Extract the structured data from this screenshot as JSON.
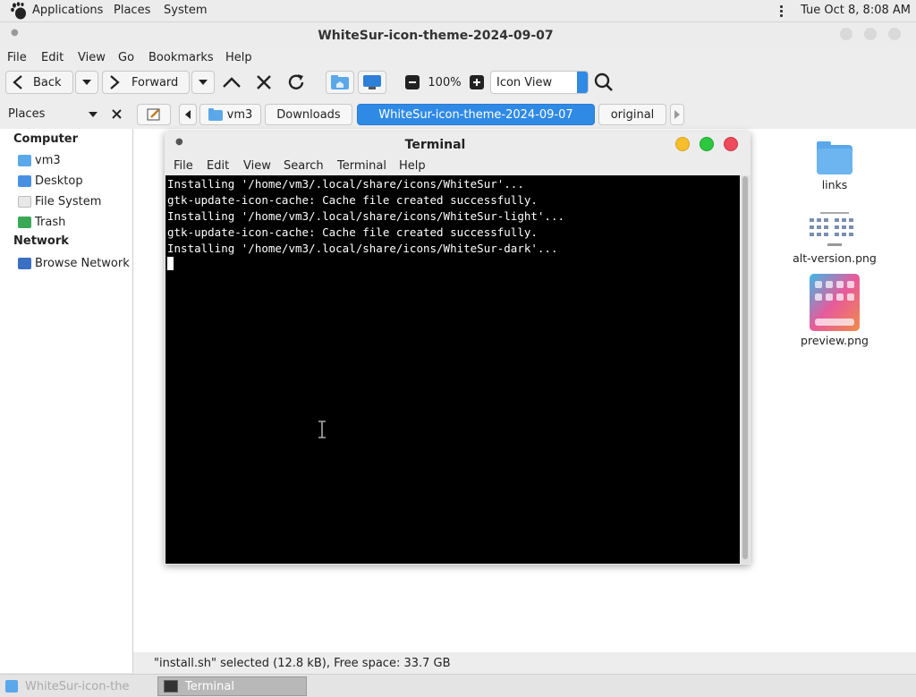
{
  "top_panel": {
    "menus": [
      "Applications",
      "Places",
      "System"
    ],
    "clock": "Tue Oct  8,  8:08 AM"
  },
  "file_manager": {
    "title": "WhiteSur-icon-theme-2024-09-07",
    "menubar": [
      "File",
      "Edit",
      "View",
      "Go",
      "Bookmarks",
      "Help"
    ],
    "toolbar": {
      "back_label": "Back",
      "forward_label": "Forward",
      "zoom_level": "100%",
      "view_mode": "Icon View"
    },
    "pathbar": {
      "crumbs": [
        "vm3",
        "Downloads",
        "WhiteSur-icon-theme-2024-09-07",
        "original"
      ],
      "active_index": 2
    },
    "sidebar": {
      "header": "Places",
      "sections": [
        {
          "title": "Computer",
          "items": [
            "vm3",
            "Desktop",
            "File System",
            "Trash"
          ]
        },
        {
          "title": "Network",
          "items": [
            "Browse Network"
          ]
        }
      ]
    },
    "files": [
      "links",
      "alt-version.png",
      "preview.png"
    ],
    "status": "\"install.sh\" selected (12.8 kB), Free space: 33.7 GB"
  },
  "terminal": {
    "title": "Terminal",
    "menubar": [
      "File",
      "Edit",
      "View",
      "Search",
      "Terminal",
      "Help"
    ],
    "lines": [
      "Installing '/home/vm3/.local/share/icons/WhiteSur'...",
      "gtk-update-icon-cache: Cache file created successfully.",
      "Installing '/home/vm3/.local/share/icons/WhiteSur-light'...",
      "gtk-update-icon-cache: Cache file created successfully.",
      "Installing '/home/vm3/.local/share/icons/WhiteSur-dark'..."
    ]
  },
  "taskbar": {
    "tasks": [
      "WhiteSur-icon-the",
      "Terminal"
    ]
  },
  "colors": {
    "accent": "#2f8ae5",
    "folder": "#5aa8ea",
    "terminal_bg": "#000000",
    "close": "#ef4b5c",
    "maximize": "#2dc840",
    "minimize": "#f6be2c"
  }
}
